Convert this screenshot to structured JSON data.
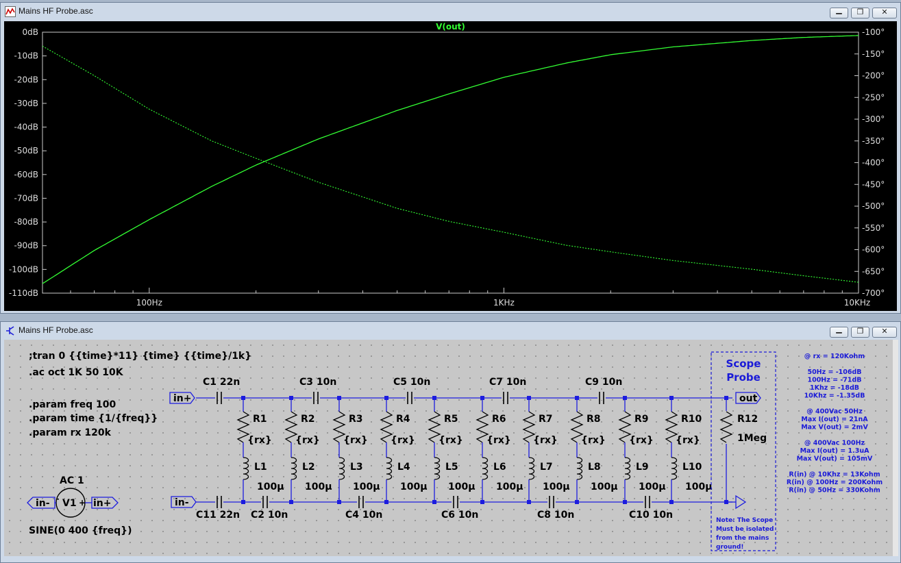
{
  "plot_window": {
    "title": "Mains HF Probe.asc",
    "trace_label": "V(out)",
    "colors": {
      "trace": "#33ff33",
      "background": "#000000",
      "axis": "#cccccc",
      "tick_text": "#dddddd"
    }
  },
  "schematic_window": {
    "title": "Mains HF Probe.asc",
    "colors": {
      "wire": "#1c1cdf",
      "component": "#000000",
      "text": "#000000",
      "note": "#1a1ad8"
    }
  },
  "chart_data": {
    "type": "line",
    "title": "V(out)",
    "x_scale": "log",
    "x_range": [
      50,
      10000
    ],
    "x_ticks": [
      {
        "value": 100,
        "label": "100Hz"
      },
      {
        "value": 1000,
        "label": "1KHz"
      },
      {
        "value": 10000,
        "label": "10KHz"
      }
    ],
    "y_left_range": [
      -110,
      0
    ],
    "y_left_ticks": [
      "0dB",
      "-10dB",
      "-20dB",
      "-30dB",
      "-40dB",
      "-50dB",
      "-60dB",
      "-70dB",
      "-80dB",
      "-90dB",
      "-100dB",
      "-110dB"
    ],
    "y_right_range": [
      -700,
      -100
    ],
    "y_right_ticks": [
      "-100°",
      "-150°",
      "-200°",
      "-250°",
      "-300°",
      "-350°",
      "-400°",
      "-450°",
      "-500°",
      "-550°",
      "-600°",
      "-650°",
      "-700°"
    ],
    "series": [
      {
        "style": "solid",
        "axis": "left",
        "x": [
          50,
          70,
          100,
          150,
          200,
          300,
          500,
          700,
          1000,
          1500,
          2000,
          3000,
          5000,
          7000,
          10000
        ],
        "y": [
          -106,
          -92,
          -79,
          -65,
          -56,
          -45,
          -33,
          -26,
          -19,
          -13,
          -9.5,
          -6.2,
          -3.5,
          -2.2,
          -1.4
        ]
      },
      {
        "style": "dotted",
        "axis": "right",
        "x": [
          50,
          70,
          100,
          150,
          200,
          300,
          500,
          700,
          1000,
          1500,
          2000,
          3000,
          5000,
          7000,
          10000
        ],
        "y": [
          -132,
          -200,
          -277,
          -350,
          -390,
          -445,
          -505,
          -535,
          -560,
          -590,
          -605,
          -625,
          -645,
          -660,
          -675
        ]
      }
    ]
  },
  "schematic": {
    "directives": [
      ";tran 0 {{time}*11} {time} {{time}/1k}",
      ".ac oct 1K 50 10K",
      ".param freq 100",
      ".param time {1/{freq}}",
      ".param rx 120k"
    ],
    "source": {
      "name": "V1",
      "label": "AC 1",
      "value": "SINE(0 400 {freq})",
      "left_port": "in-",
      "right_port": "in+"
    },
    "ports": {
      "in_plus": "in+",
      "in_minus": "in-",
      "out": "out"
    },
    "top_caps": [
      {
        "name": "C1",
        "value": "22n"
      },
      {
        "name": "C3",
        "value": "10n"
      },
      {
        "name": "C5",
        "value": "10n"
      },
      {
        "name": "C7",
        "value": "10n"
      },
      {
        "name": "C9",
        "value": "10n"
      }
    ],
    "bottom_caps": [
      {
        "name": "C11",
        "value": "22n"
      },
      {
        "name": "C2",
        "value": "10n"
      },
      {
        "name": "C4",
        "value": "10n"
      },
      {
        "name": "C6",
        "value": "10n"
      },
      {
        "name": "C8",
        "value": "10n"
      },
      {
        "name": "C10",
        "value": "10n"
      }
    ],
    "branches": [
      {
        "r": "R1",
        "rv": "{rx}",
        "l": "L1",
        "lv": "100µ"
      },
      {
        "r": "R2",
        "rv": "{rx}",
        "l": "L2",
        "lv": "100µ"
      },
      {
        "r": "R3",
        "rv": "{rx}",
        "l": "L3",
        "lv": "100µ"
      },
      {
        "r": "R4",
        "rv": "{rx}",
        "l": "L4",
        "lv": "100µ"
      },
      {
        "r": "R5",
        "rv": "{rx}",
        "l": "L5",
        "lv": "100µ"
      },
      {
        "r": "R6",
        "rv": "{rx}",
        "l": "L6",
        "lv": "100µ"
      },
      {
        "r": "R7",
        "rv": "{rx}",
        "l": "L7",
        "lv": "100µ"
      },
      {
        "r": "R8",
        "rv": "{rx}",
        "l": "L8",
        "lv": "100µ"
      },
      {
        "r": "R9",
        "rv": "{rx}",
        "l": "L9",
        "lv": "100µ"
      },
      {
        "r": "R10",
        "rv": "{rx}",
        "l": "L10",
        "lv": "100µ"
      }
    ],
    "load": {
      "name": "R12",
      "value": "1Meg"
    },
    "probe_title": [
      "Scope",
      "Probe"
    ],
    "probe_note": [
      "Note: The Scope",
      "Must be isolated",
      "from the mains",
      "ground!"
    ],
    "side_notes": [
      "@ rx = 120Kohm",
      "",
      "50Hz = -106dB",
      "100Hz = -71dB",
      "1Khz = -18dB",
      "10Khz = -1.35dB",
      "",
      "@ 400Vac 50Hz",
      "Max I(out) = 21nA",
      "Max V(out) = 2mV",
      "",
      "@ 400Vac 100Hz",
      "Max I(out) = 1.3uA",
      "Max V(out) = 105mV",
      "",
      "R(in) @ 10Khz = 13Kohm",
      "R(in) @ 100Hz = 200Kohm",
      "R(in) @ 50Hz = 330Kohm"
    ]
  }
}
